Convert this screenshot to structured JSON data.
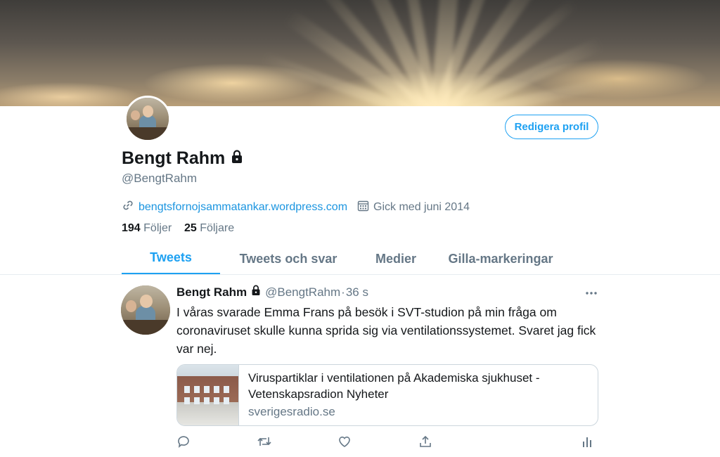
{
  "profile": {
    "name": "Bengt Rahm",
    "handle": "@BengtRahm",
    "website": "bengtsfornojsammatankar.wordpress.com",
    "joined": "Gick med juni 2014",
    "following_count": "194",
    "following_label": "Följer",
    "followers_count": "25",
    "followers_label": "Följare",
    "edit_button": "Redigera profil"
  },
  "tabs": [
    "Tweets",
    "Tweets och svar",
    "Medier",
    "Gilla-markeringar"
  ],
  "active_tab": "Tweets",
  "tweet": {
    "author_name": "Bengt Rahm",
    "author_handle": "@BengtRahm",
    "separator": "·",
    "time": "36 s",
    "text": "I våras svarade Emma Frans på besök i SVT-studion på min fråga om coronaviruset skulle kunna sprida sig via ventilationssystemet. Svaret jag fick var nej.",
    "card": {
      "title": "Viruspartiklar i ventilationen på Akademiska sjukhuset - Vetenskapsradion Nyheter",
      "domain": "sverigesradio.se"
    }
  },
  "icons": {
    "link": "link-icon",
    "calendar": "calendar-icon",
    "lock": "lock-icon",
    "more": "more-icon",
    "reply": "reply-icon",
    "retweet": "retweet-icon",
    "like": "like-icon",
    "share": "share-icon",
    "analytics": "analytics-icon"
  },
  "colors": {
    "accent": "#1da1f2",
    "link": "#1b95e0",
    "secondary_text": "#657786",
    "border": "#e6ecf0"
  }
}
